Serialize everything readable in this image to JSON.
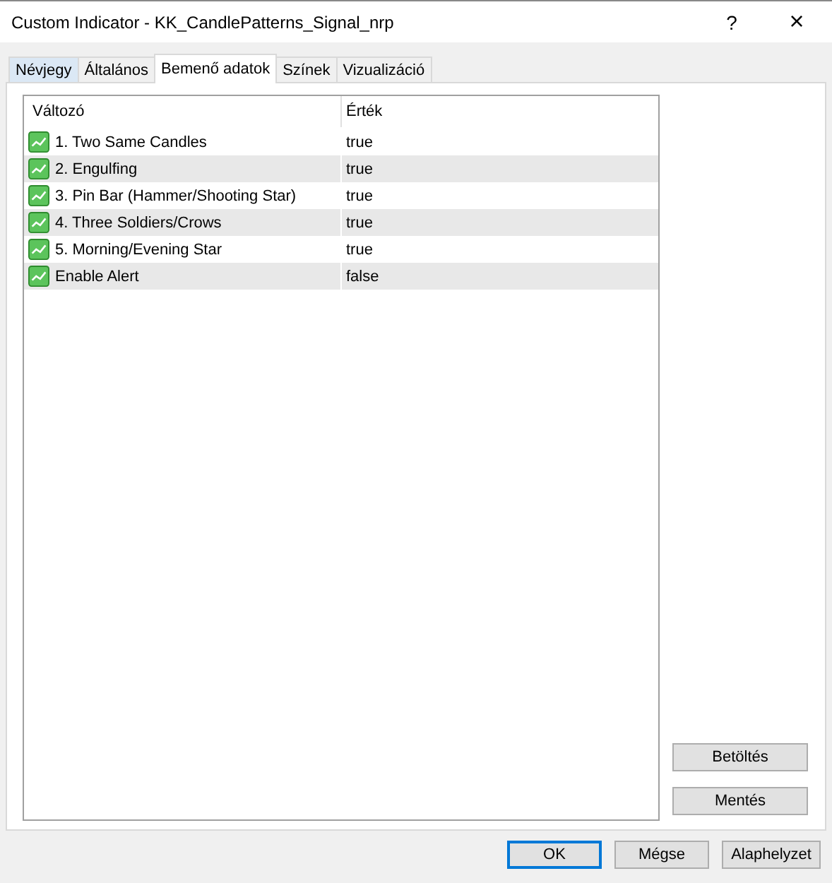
{
  "window": {
    "title": "Custom Indicator - KK_CandlePatterns_Signal_nrp",
    "help": "?",
    "close": "×"
  },
  "tabs": [
    {
      "label": "Névjegy",
      "selected": false
    },
    {
      "label": "Általános",
      "selected": false
    },
    {
      "label": "Bemenő adatok",
      "selected": true
    },
    {
      "label": "Színek",
      "selected": false
    },
    {
      "label": "Vizualizáció",
      "selected": false
    }
  ],
  "table": {
    "columns": [
      "Változó",
      "Érték"
    ],
    "rows": [
      {
        "name": "1. Two Same Candles",
        "value": "true"
      },
      {
        "name": "2. Engulfing",
        "value": "true"
      },
      {
        "name": "3. Pin Bar (Hammer/Shooting Star)",
        "value": "true"
      },
      {
        "name": "4. Three Soldiers/Crows",
        "value": "true"
      },
      {
        "name": "5. Morning/Evening Star",
        "value": "true"
      },
      {
        "name": "Enable Alert",
        "value": "false"
      }
    ]
  },
  "side_buttons": [
    "Betöltés",
    "Mentés"
  ],
  "buttons": [
    {
      "label": "OK",
      "default": true
    },
    {
      "label": "Mégse",
      "default": false
    },
    {
      "label": "Alaphelyzet",
      "default": false
    }
  ]
}
